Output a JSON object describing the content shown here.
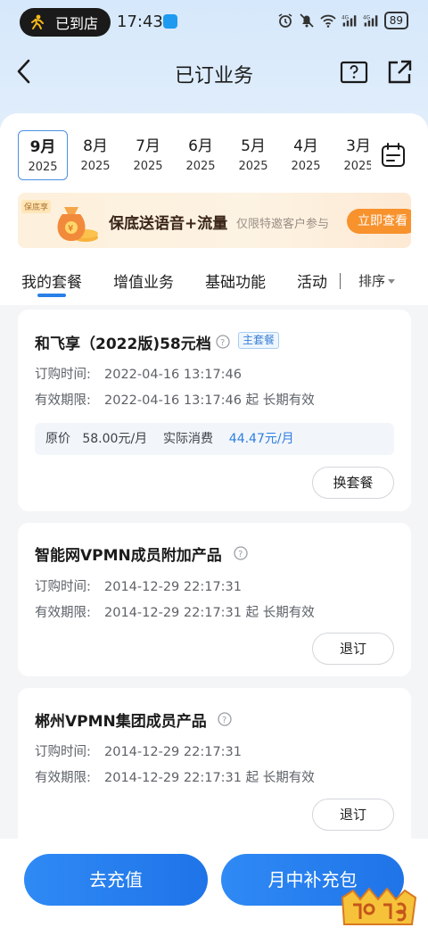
{
  "status_bar": {
    "store_label": "已到店",
    "time": "17:43",
    "battery": "89",
    "signal_1": "4G",
    "signal_2": "4G"
  },
  "nav": {
    "title": "已订业务"
  },
  "months": [
    {
      "month": "9月",
      "year": "2025",
      "active": true
    },
    {
      "month": "8月",
      "year": "2025"
    },
    {
      "month": "7月",
      "year": "2025"
    },
    {
      "month": "6月",
      "year": "2025"
    },
    {
      "month": "5月",
      "year": "2025"
    },
    {
      "month": "4月",
      "year": "2025"
    },
    {
      "month": "3月",
      "year": "2025"
    }
  ],
  "banner": {
    "tag": "保底享",
    "title": "保底送语音+流量",
    "subtitle": "仅限特邀客户参与",
    "button": "立即查看"
  },
  "categories": {
    "tab_1": "我的套餐",
    "tab_2": "增值业务",
    "tab_3": "基础功能",
    "tab_4": "活动",
    "sort": "排序"
  },
  "cards": [
    {
      "title": "和飞享（2022版)58元档",
      "badge": "主套餐",
      "order_label": "订购时间:",
      "order_time": "2022-04-16 13:17:46",
      "valid_label": "有效期限:",
      "valid_time": "2022-04-16 13:17:46 起 长期有效",
      "original_price_label": "原价",
      "original_price": "58.00元/月",
      "actual_label": "实际消费",
      "actual_price": "44.47元/月",
      "button": "换套餐"
    },
    {
      "title": "智能网VPMN成员附加产品",
      "order_label": "订购时间:",
      "order_time": "2014-12-29 22:17:31",
      "valid_label": "有效期限:",
      "valid_time": "2014-12-29 22:17:31 起 长期有效",
      "button": "退订"
    },
    {
      "title": "郴州VPMN集团成员产品",
      "order_label": "订购时间:",
      "order_time": "2014-12-29 22:17:31",
      "valid_label": "有效期限:",
      "valid_time": "2014-12-29 22:17:31 起 长期有效",
      "button": "退订"
    }
  ],
  "bottom": {
    "recharge": "去充值",
    "midmonth": "月中补充包"
  },
  "colors": {
    "accent": "#2a7fe8",
    "banner_button": "#f7922d",
    "highlight_price": "#2f7ee0"
  }
}
